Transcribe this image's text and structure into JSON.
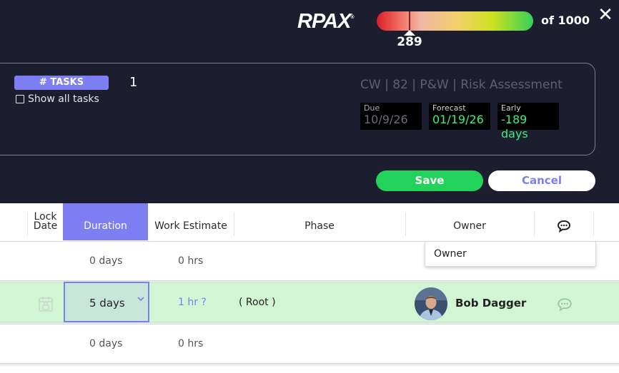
{
  "header": {
    "logo_text": "RPAX",
    "logo_mark": "®",
    "score": "289",
    "score_total": "of 1000",
    "score_fraction": 0.289
  },
  "card": {
    "tasks_label": "# TASKS",
    "tasks_count": "1",
    "show_all_label": "Show all tasks",
    "title": "CW | 82 | P&W | Risk Assessment",
    "due_label": "Due",
    "due_value": "10/9/26",
    "forecast_label": "Forecast",
    "forecast_value": "01/19/26",
    "early_label": "Early",
    "early_value": "-189 days"
  },
  "actions": {
    "save_label": "Save",
    "cancel_label": "Cancel"
  },
  "table": {
    "columns": {
      "lock_date_line1": "Lock",
      "lock_date_line2": "Date",
      "duration": "Duration",
      "work_estimate": "Work Estimate",
      "phase": "Phase",
      "owner": "Owner"
    },
    "owner_input_value": "Owner",
    "rows": [
      {
        "duration": "0 days",
        "work_estimate": "0 hrs"
      },
      {
        "duration": "5 days",
        "work_estimate": "1 hr ?",
        "phase": "( Root )",
        "owner": "Bob Dagger"
      },
      {
        "duration": "0 days",
        "work_estimate": "0 hrs"
      }
    ]
  },
  "colors": {
    "accent": "#7c7ef2",
    "save": "#22d25a",
    "positive": "#3af07a",
    "background": "#1c1d2e",
    "selected_row": "#d2f5d4"
  },
  "icons": {
    "close": "close-icon",
    "checkbox": "checkbox-icon",
    "comment": "comment-icon",
    "lock": "lock-icon",
    "chevron": "chevron-down-icon"
  }
}
